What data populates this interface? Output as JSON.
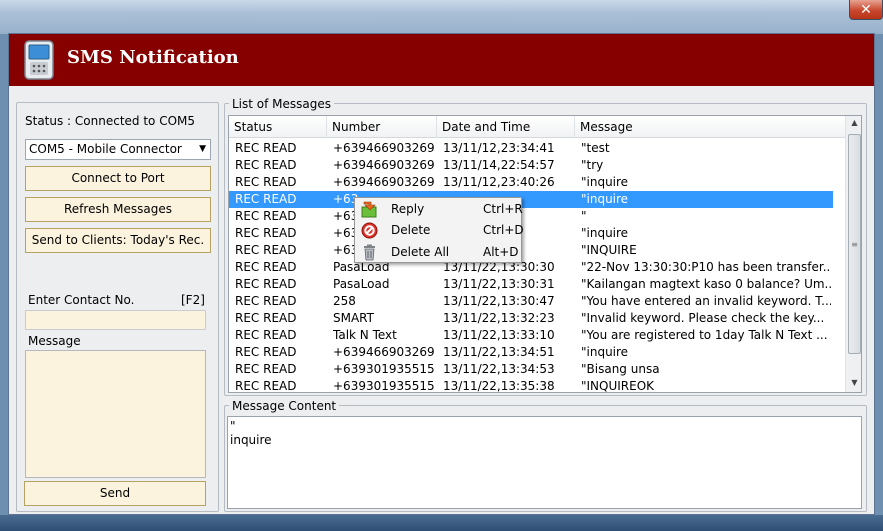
{
  "app": {
    "title": "SMS Notification"
  },
  "left_panel": {
    "status_label": "Status : Connected  to   COM5",
    "port_select_value": "COM5 - Mobile Connector",
    "buttons": {
      "connect": "Connect to Port",
      "refresh": "Refresh Messages",
      "send_clients": "Send to Clients: Today's Rec."
    },
    "contact_label": "Enter Contact No.",
    "contact_shortcut": "[F2]",
    "contact_value": "",
    "message_label": "Message",
    "message_value": "",
    "send_button": "Send"
  },
  "messages": {
    "group_title": "List of Messages",
    "columns": [
      "Status",
      "Number",
      "Date and Time",
      "Message"
    ],
    "rows": [
      {
        "status": "REC READ",
        "number": "+639466903269",
        "datetime": "13/11/12,23:34:41",
        "message": "\"test"
      },
      {
        "status": "REC READ",
        "number": "+639466903269",
        "datetime": "13/11/14,22:54:57",
        "message": "\"try"
      },
      {
        "status": "REC READ",
        "number": "+639466903269",
        "datetime": "13/11/12,23:40:26",
        "message": "\"inquire"
      },
      {
        "status": "REC READ",
        "number": "+63",
        "datetime": "",
        "message": "\"inquire",
        "selected": true
      },
      {
        "status": "REC READ",
        "number": "+63",
        "datetime": "",
        "message": "\""
      },
      {
        "status": "REC READ",
        "number": "+63",
        "datetime": "",
        "message": "\"inquire"
      },
      {
        "status": "REC READ",
        "number": "+63",
        "datetime": "",
        "message": "\"INQUIRE"
      },
      {
        "status": "REC READ",
        "number": "PasaLoad",
        "datetime": "13/11/22,13:30:30",
        "message": "\"22-Nov 13:30:30:P10 has been transfer..."
      },
      {
        "status": "REC READ",
        "number": "PasaLoad",
        "datetime": "13/11/22,13:30:31",
        "message": "\"Kailangan magtext kaso 0 balance? Um..."
      },
      {
        "status": "REC READ",
        "number": "258",
        "datetime": "13/11/22,13:30:47",
        "message": "\"You have entered an invalid keyword. T..."
      },
      {
        "status": "REC READ",
        "number": "SMART",
        "datetime": "13/11/22,13:32:23",
        "message": "\"Invalid keyword. Please check the key..."
      },
      {
        "status": "REC READ",
        "number": "Talk N Text",
        "datetime": "13/11/22,13:33:10",
        "message": "\"You are registered to 1day Talk N Text ..."
      },
      {
        "status": "REC READ",
        "number": "+639466903269",
        "datetime": "13/11/22,13:34:51",
        "message": "\"inquire"
      },
      {
        "status": "REC READ",
        "number": "+639301935515",
        "datetime": "13/11/22,13:34:53",
        "message": "\"Bisang unsa"
      },
      {
        "status": "REC READ",
        "number": "+639301935515",
        "datetime": "13/11/22,13:35:38",
        "message": "\"INQUIREOK"
      }
    ]
  },
  "context_menu": {
    "items": [
      {
        "label": "Reply",
        "shortcut": "Ctrl+R",
        "icon": "reply-icon"
      },
      {
        "label": "Delete",
        "shortcut": "Ctrl+D",
        "icon": "delete-icon"
      },
      {
        "label": "Delete All",
        "shortcut": "Alt+D",
        "icon": "trash-icon"
      }
    ]
  },
  "content": {
    "group_title": "Message Content",
    "text": "\"\ninquire"
  },
  "colors": {
    "banner": "#860000",
    "selection": "#3399ff",
    "button_bg": "#fbf3dd",
    "close_button": "#c9472d"
  }
}
